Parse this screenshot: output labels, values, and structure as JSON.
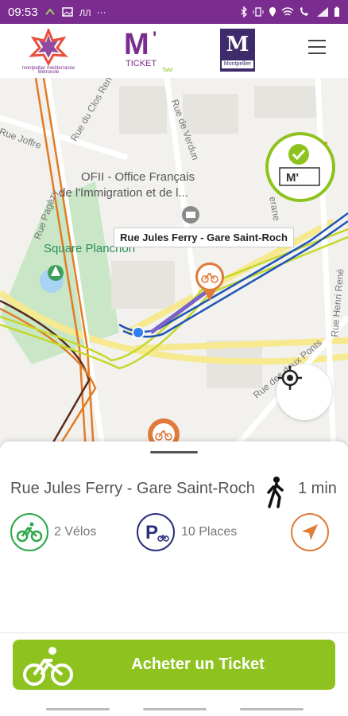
{
  "statusbar": {
    "time": "09:53",
    "notif": "···"
  },
  "header": {
    "metro_logo": "montpellier méditerranée Métropole",
    "ticket_logo": "TICKET",
    "city_logo_big": "M",
    "city_logo_small": "Montpellier"
  },
  "map": {
    "streets": [
      "Rue Joffre",
      "Rue du Clos René",
      "Rue de Verdun",
      "Rue Pagèzy",
      "Rue des deux Ponts",
      "Rue Henri René",
      "erane"
    ],
    "poi_line1": "OFII - Office Français",
    "poi_line2": "de l'Immigration et de l...",
    "park": "Square Planchon",
    "tooltip": "Rue Jules Ferry - Gare Saint-Roch"
  },
  "sheet": {
    "station_name": "Rue Jules Ferry - Gare Saint-Roch",
    "walk_time": "1 min",
    "bikes": "2 Vélos",
    "places": "10 Places",
    "buy_label": "Acheter un Ticket"
  },
  "colors": {
    "brand": "#7b2c8f",
    "green": "#8ec31f",
    "bike_green": "#2ea84a",
    "navy": "#2b2f7a",
    "orange": "#e07b3a"
  }
}
